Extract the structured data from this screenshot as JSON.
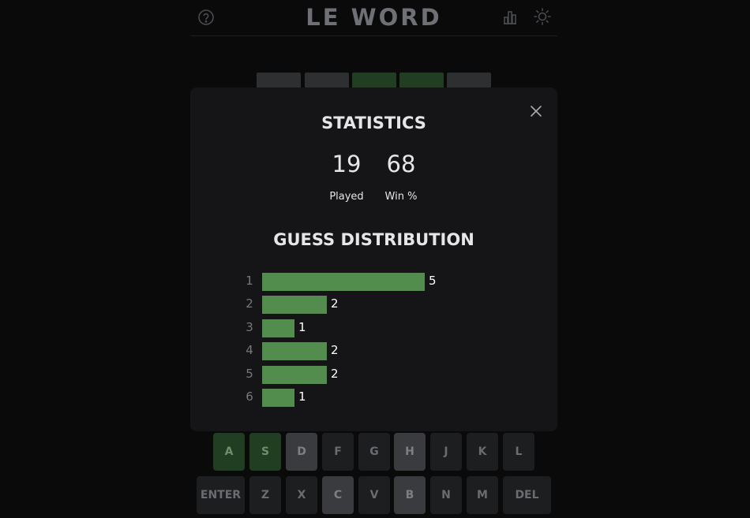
{
  "app": {
    "title": "LE WORD"
  },
  "header": {
    "help_icon": "question-circle-icon",
    "stats_icon": "bar-chart-icon",
    "theme_icon": "sun-icon"
  },
  "colors": {
    "correct": "#538d4e",
    "correct_dim": "#213d22",
    "absent": "#3a3b3e",
    "key_default": "#1d1e20",
    "modal_bg": "#151517",
    "page_bg": "#0a0a0b"
  },
  "board": {
    "visible_tile_states": [
      "absent",
      "absent",
      "correct",
      "correct",
      "absent"
    ]
  },
  "modal": {
    "close_icon": "close-icon",
    "title": "STATISTICS",
    "stats": [
      {
        "value": "19",
        "label": "Played"
      },
      {
        "value": "68",
        "label": "Win %"
      }
    ],
    "distribution_title": "GUESS DISTRIBUTION",
    "distribution": [
      {
        "guess": "1",
        "count": "5"
      },
      {
        "guess": "2",
        "count": "2"
      },
      {
        "guess": "3",
        "count": "1"
      },
      {
        "guess": "4",
        "count": "2"
      },
      {
        "guess": "5",
        "count": "2"
      },
      {
        "guess": "6",
        "count": "1"
      }
    ]
  },
  "keyboard": {
    "rows": [
      [
        {
          "label": "A",
          "state": "correct"
        },
        {
          "label": "S",
          "state": "correct"
        },
        {
          "label": "D",
          "state": "absent"
        },
        {
          "label": "F",
          "state": "default"
        },
        {
          "label": "G",
          "state": "default"
        },
        {
          "label": "H",
          "state": "absent"
        },
        {
          "label": "J",
          "state": "default"
        },
        {
          "label": "K",
          "state": "default"
        },
        {
          "label": "L",
          "state": "default"
        }
      ],
      [
        {
          "label": "ENTER",
          "state": "default"
        },
        {
          "label": "Z",
          "state": "default"
        },
        {
          "label": "X",
          "state": "default"
        },
        {
          "label": "C",
          "state": "absent"
        },
        {
          "label": "V",
          "state": "default"
        },
        {
          "label": "B",
          "state": "absent"
        },
        {
          "label": "N",
          "state": "default"
        },
        {
          "label": "M",
          "state": "default"
        },
        {
          "label": "DEL",
          "state": "default"
        }
      ]
    ]
  }
}
